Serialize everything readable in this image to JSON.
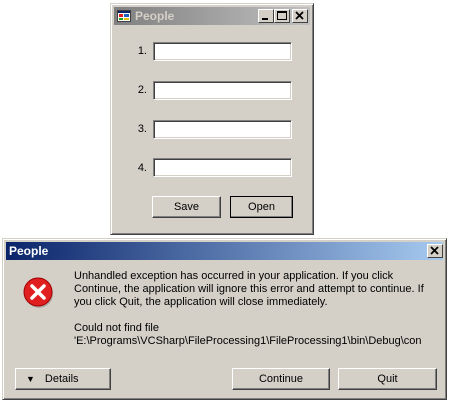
{
  "main_window": {
    "title": "People",
    "rows": [
      {
        "label": "1.",
        "value": ""
      },
      {
        "label": "2.",
        "value": ""
      },
      {
        "label": "3.",
        "value": ""
      },
      {
        "label": "4.",
        "value": ""
      }
    ],
    "save_label": "Save",
    "open_label": "Open"
  },
  "error_dialog": {
    "title": "People",
    "message_1": "Unhandled exception has occurred in your application. If you click",
    "message_2": "Continue, the application will ignore this error and attempt to continue. If",
    "message_3": "you click Quit, the application will close immediately.",
    "detail_1": "Could not find file",
    "detail_2": "'E:\\Programs\\VCSharp\\FileProcessing1\\FileProcessing1\\bin\\Debug\\con",
    "details_label": "Details",
    "continue_label": "Continue",
    "quit_label": "Quit"
  },
  "icons": {
    "app_icon": "window-app-icon",
    "minimize": "minimize-icon",
    "maximize": "maximize-icon",
    "close": "close-icon",
    "error": "error-icon",
    "details_arrow": "chevron-down-icon"
  },
  "colors": {
    "face": "#d4d0c8",
    "active_title_start": "#0a246a",
    "active_title_end": "#a6caf0",
    "inactive_title_start": "#808080",
    "inactive_title_end": "#c0c0c0",
    "error_red": "#e02020"
  }
}
